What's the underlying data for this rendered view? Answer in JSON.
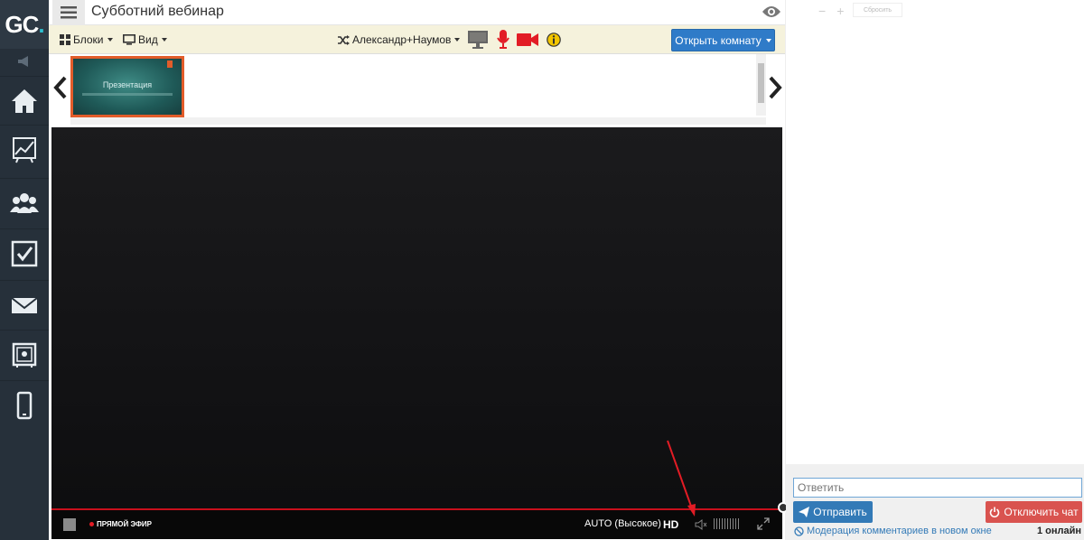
{
  "app": {
    "logo": {
      "text": "GC",
      "dot": "."
    },
    "title": "Субботний вебинар"
  },
  "toolbar": {
    "blocks_label": "Блоки",
    "view_label": "Вид",
    "participants_label": "Александр+Наумов",
    "open_room_label": "Открыть комнату"
  },
  "slides": [
    {
      "title": "Презентация"
    }
  ],
  "video": {
    "live_label": "ПРЯМОЙ ЭФИР",
    "quality_label": "AUTO (Высокое)",
    "hd_label": "HD"
  },
  "chat": {
    "zoom_minus": "−",
    "zoom_plus": "+",
    "reset_label": "Сбросить",
    "reply_placeholder": "Ответить",
    "send_label": "Отправить",
    "disable_chat_label": "Отключить чат",
    "moderation_link": "Модерация комментариев в новом окне",
    "online_count": "1 онлайн"
  },
  "nav": [
    "home-icon",
    "chart-icon",
    "users-icon",
    "checkbox-icon",
    "mail-icon",
    "safe-icon",
    "mobile-icon"
  ],
  "colors": {
    "nav_bg": "#26303a",
    "accent_blue": "#2f7bc8",
    "danger_red": "#d9534f",
    "live_red": "#e21c25",
    "toolbar_bg": "#f5f2dc"
  }
}
